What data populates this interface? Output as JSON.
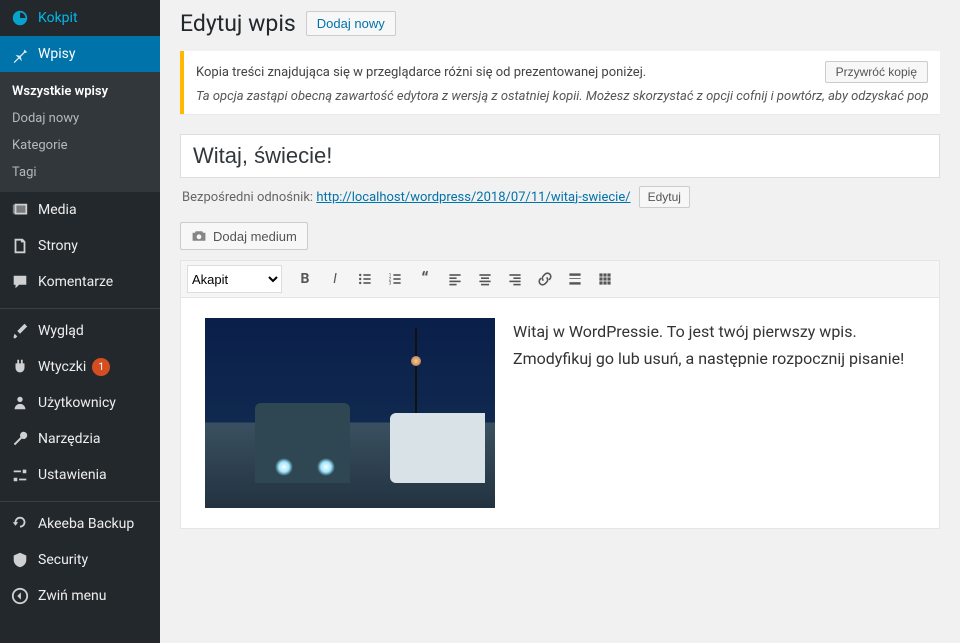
{
  "sidebar": {
    "kokpit": "Kokpit",
    "wpisy": "Wpisy",
    "submenu": {
      "wszystkie": "Wszystkie wpisy",
      "dodaj": "Dodaj nowy",
      "kategorie": "Kategorie",
      "tagi": "Tagi"
    },
    "media": "Media",
    "strony": "Strony",
    "komentarze": "Komentarze",
    "wyglad": "Wygląd",
    "wtyczki": "Wtyczki",
    "wtyczki_badge": "1",
    "uzytkownicy": "Użytkownicy",
    "narzedzia": "Narzędzia",
    "ustawienia": "Ustawienia",
    "akeeba": "Akeeba Backup",
    "security": "Security",
    "zwin": "Zwiń menu"
  },
  "page": {
    "title": "Edytuj wpis",
    "add_new": "Dodaj nowy"
  },
  "notice": {
    "line1": "Kopia treści znajdująca się w przeglądarce różni się od prezentowanej poniżej.",
    "restore": "Przywróć kopię",
    "line2": "Ta opcja zastąpi obecną zawartość edytora z wersją z ostatniej kopii. Możesz skorzystać z opcji cofnij i powtórz, aby odzyskać poprzedni"
  },
  "post": {
    "title": "Witaj, świecie!",
    "permalink_label": "Bezpośredni odnośnik:",
    "permalink_url_base": "http://localhost/wordpress/2018/07/11/",
    "permalink_slug": "witaj-swiecie/",
    "edit": "Edytuj",
    "media_button": "Dodaj medium",
    "format_select": "Akapit",
    "content": "Witaj w WordPressie. To jest twój pierwszy wpis. Zmodyfikuj go lub usuń, a następnie rozpocznij pisanie!"
  }
}
